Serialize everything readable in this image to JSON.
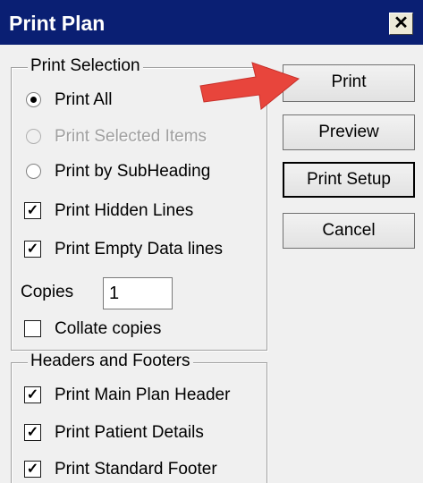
{
  "window": {
    "title": "Print Plan",
    "close_label": "✕"
  },
  "print_selection": {
    "title": "Print Selection",
    "options": [
      {
        "label": "Print All",
        "selected": true,
        "disabled": false
      },
      {
        "label": "Print Selected Items",
        "selected": false,
        "disabled": true
      },
      {
        "label": "Print by SubHeading",
        "selected": false,
        "disabled": false
      }
    ],
    "print_hidden_lines": {
      "label": "Print Hidden Lines",
      "checked": true
    },
    "print_empty_data_lines": {
      "label": "Print Empty Data lines",
      "checked": true
    },
    "copies": {
      "label": "Copies",
      "value": "1"
    },
    "collate": {
      "label": "Collate copies",
      "checked": false
    }
  },
  "headers_footers": {
    "title": "Headers and Footers",
    "items": [
      {
        "label": "Print Main Plan Header",
        "checked": true
      },
      {
        "label": "Print Patient Details",
        "checked": true
      },
      {
        "label": "Print Standard Footer",
        "checked": true
      }
    ]
  },
  "buttons": {
    "print": "Print",
    "preview": "Preview",
    "print_setup": "Print Setup",
    "cancel": "Cancel"
  },
  "annotation": {
    "arrow_color": "#e8453c",
    "arrow_icon": "red-arrow-icon"
  },
  "colors": {
    "titlebar": "#0a1f73"
  }
}
